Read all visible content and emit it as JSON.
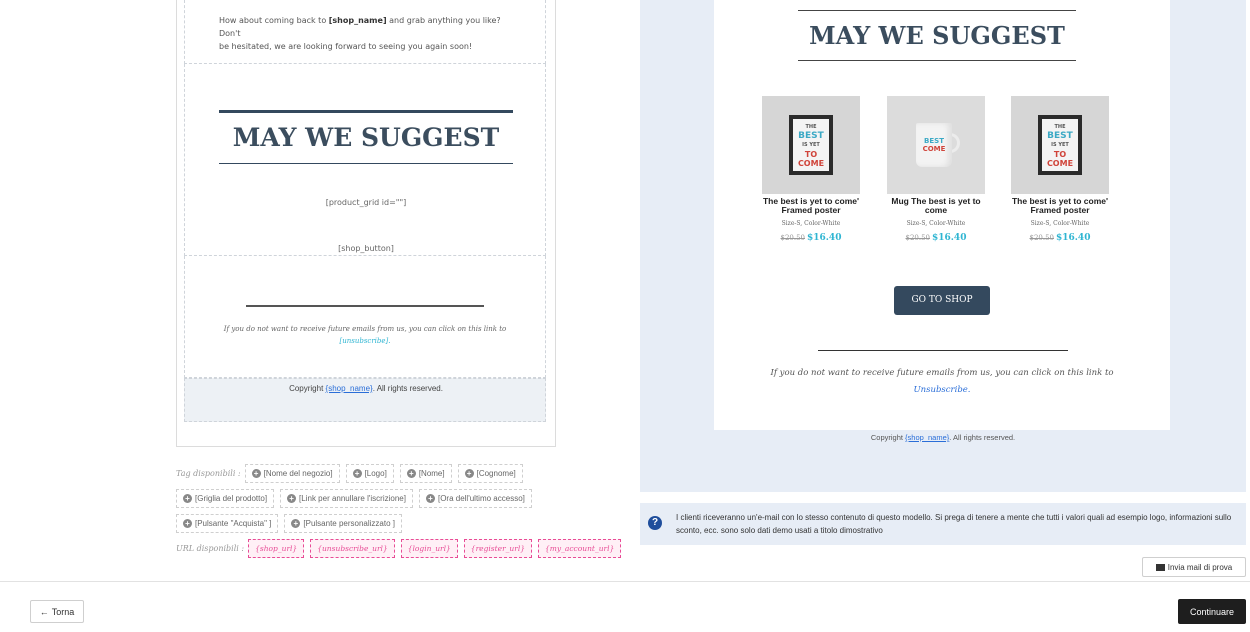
{
  "editor": {
    "intro_line1_a": "How about coming back to ",
    "intro_shop_tag": "[shop_name]",
    "intro_line1_b": " and grab anything you like? Don't",
    "intro_line2": "be hesitated, we are looking forward to seeing you again soon!",
    "title": "MAY WE SUGGEST",
    "product_grid_code": "[product_grid id=\"\"]",
    "shop_button_code": "[shop_button]",
    "unsubscribe_text": "If you do not want to receive future emails from us, you can click on this link to",
    "unsubscribe_link": "[unsubscribe].",
    "footer_a": "Copyright ",
    "footer_link": "{shop_name}",
    "footer_b": ". All rights reserved."
  },
  "tags": {
    "label": "Tag disponibili :",
    "items": [
      "[Nome del negozio]",
      "[Logo]",
      "[Nome]",
      "[Cognome]",
      "[Griglia del prodotto]",
      "[Link per annullare l'iscrizione]",
      "[Ora dell'ultimo accesso]",
      "[Pulsante \"Acquista\" ]",
      "[Pulsante personalizzato ]"
    ]
  },
  "urls": {
    "label": "URL disponibili :",
    "items": [
      "{shop_url}",
      "{unsubscribe_url}",
      "{login_url}",
      "{register_url}",
      "{my_account_url}"
    ]
  },
  "preview": {
    "title": "MAY WE SUGGEST",
    "products": [
      {
        "name": "The best is yet to come' Framed poster",
        "attr": "Size-S, Color-White",
        "old_price": "$20.50",
        "price": "$16.40",
        "image": "framed-poster"
      },
      {
        "name": "Mug The best is yet to come",
        "attr": "Size-S, Color-White",
        "old_price": "$20.50",
        "price": "$16.40",
        "image": "mug"
      },
      {
        "name": "The best is yet to come' Framed poster",
        "attr": "Size-S, Color-White",
        "old_price": "$20.50",
        "price": "$16.40",
        "image": "framed-poster"
      }
    ],
    "poster_text": {
      "line1": "THE",
      "line2": "BEST",
      "line3": "IS YET",
      "line4": "TO",
      "line5": "COME"
    },
    "shop_button": "GO TO SHOP",
    "unsubscribe_text": "If you do not want to receive future emails from us, you can click on this link to",
    "unsubscribe_link": "Unsubscribe.",
    "footer_a": "Copyright ",
    "footer_link": "{shop_name}",
    "footer_b": ". All rights reserved."
  },
  "info": {
    "icon": "question-circle-icon",
    "text": "I clienti riceveranno un'e-mail con lo stesso contenuto di questo modello. Si prega di tenere a mente che tutti i valori quali ad esempio logo, informazioni sullo sconto, ecc. sono solo dati demo usati a titolo dimostrativo"
  },
  "buttons": {
    "send_test": "Invia mail di prova",
    "back": "Torna",
    "continue": "Continuare"
  },
  "colors": {
    "accent": "#2fb5d2",
    "title_dark": "#34495e",
    "url_pink": "#e84c96",
    "preview_bg": "#e7edf6"
  }
}
